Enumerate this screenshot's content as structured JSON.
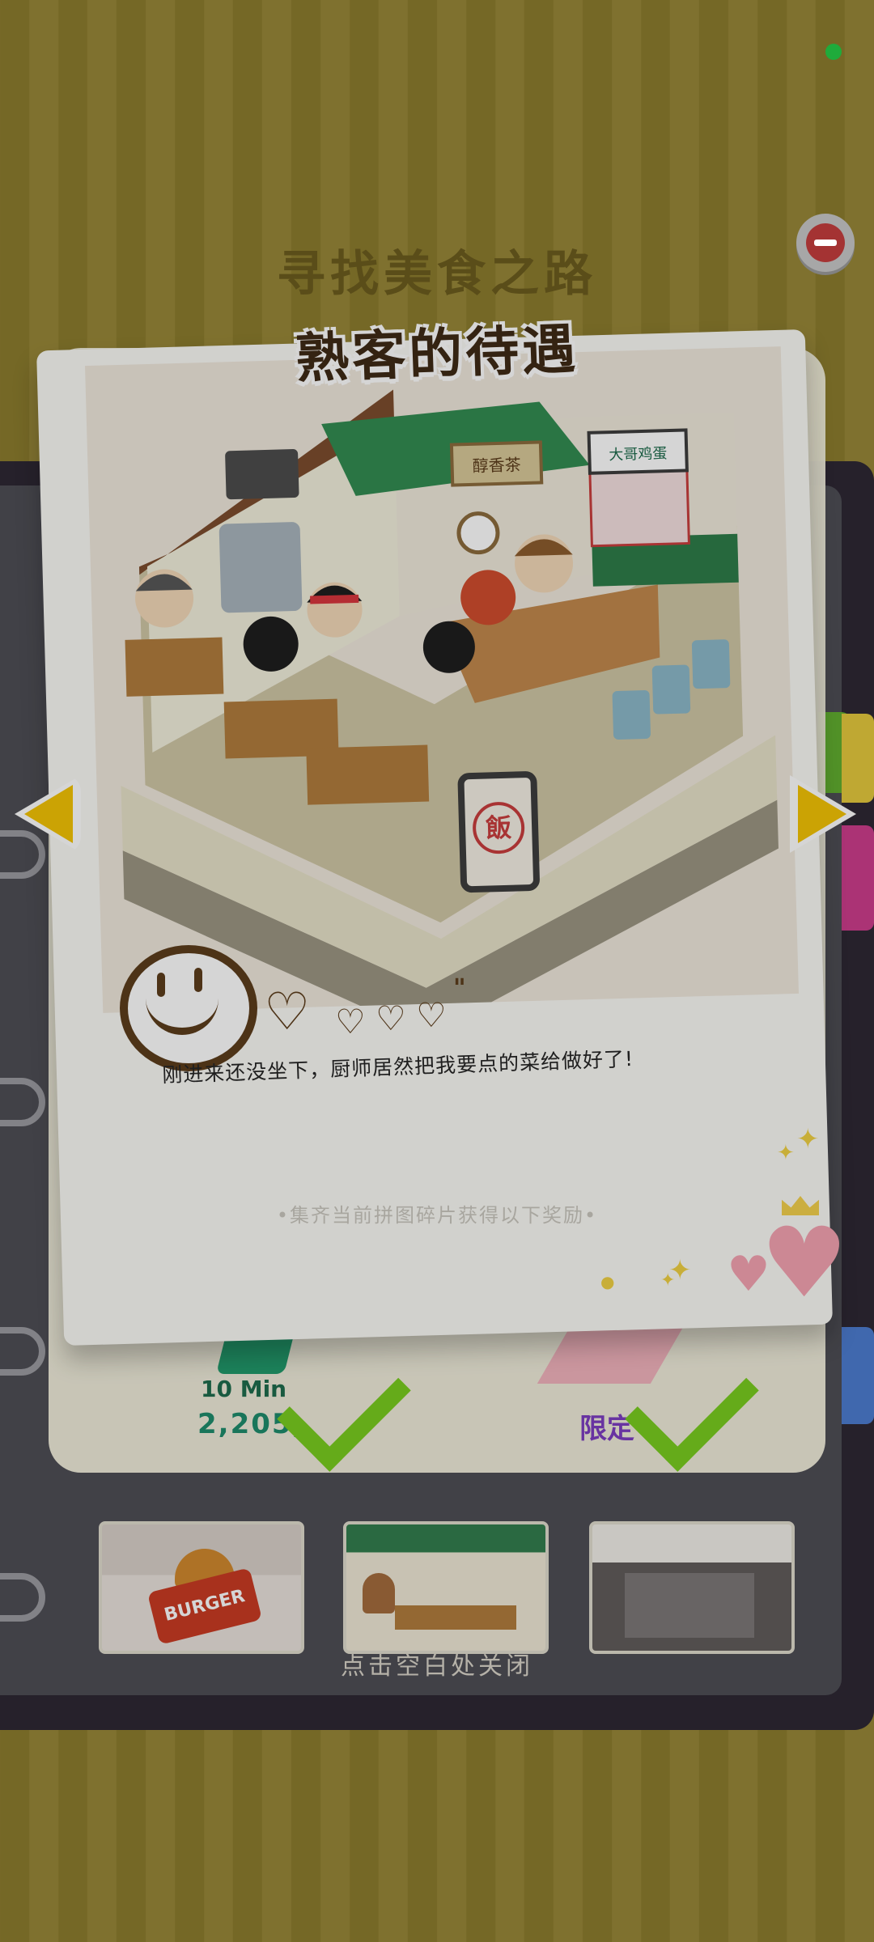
{
  "background_title": "寻找美食之路",
  "card": {
    "title": "熟客的待遇",
    "caption": "刚进来还没坐下，厨师居然把我要点的菜给做好了!",
    "sign_left": "醇香茶",
    "sign_right": "大哥鸡蛋",
    "sign_board": "飯",
    "reward_hint": "•集齐当前拼图碎片获得以下奖励•"
  },
  "rewards": {
    "left_time": "10 Min",
    "left_amount": "2,205,",
    "right_label": "限定"
  },
  "thumbnails": [
    {
      "name": "burger-shop",
      "sign_text": "BURGER"
    },
    {
      "name": "tea-restaurant"
    },
    {
      "name": "street-shop"
    }
  ],
  "close_hint": "点击空白处关闭",
  "colors": {
    "accent_yellow": "#f3c200",
    "check_green": "#77cc1c",
    "title_brown": "#3b2612",
    "background_olive": "#8a7a2a"
  }
}
